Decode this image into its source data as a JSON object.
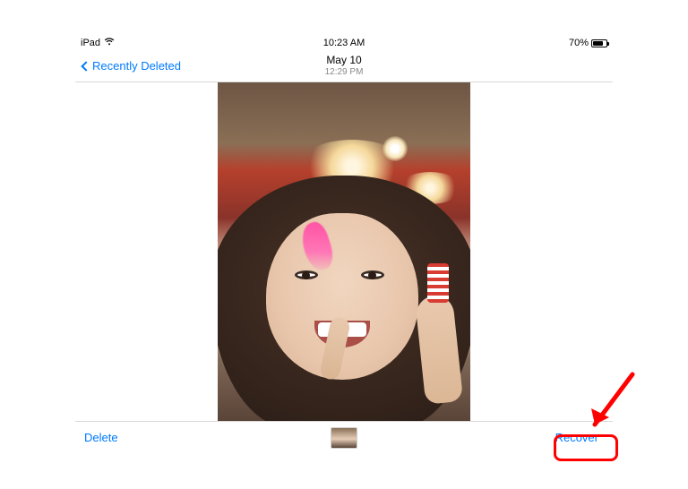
{
  "status": {
    "device": "iPad",
    "time": "10:23 AM",
    "battery_pct": "70%"
  },
  "nav": {
    "back_label": "Recently Deleted",
    "title": "May 10",
    "subtitle": "12:29 PM"
  },
  "toolbar": {
    "delete_label": "Delete",
    "recover_label": "Recover"
  }
}
